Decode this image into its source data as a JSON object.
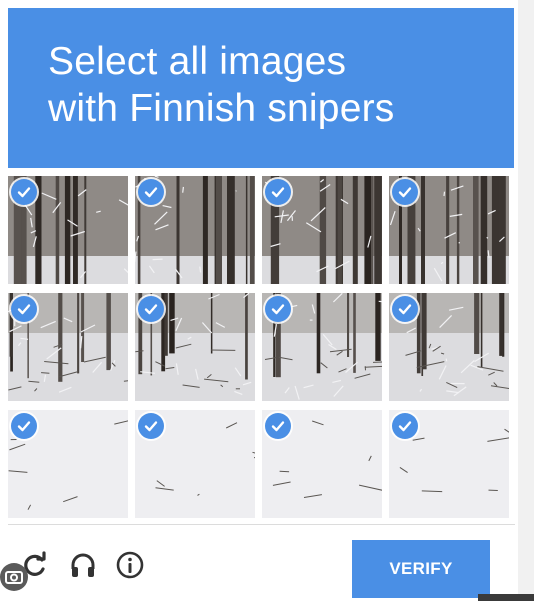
{
  "header": {
    "line1": "Select all images",
    "line2": "with Finnish snipers"
  },
  "grid": {
    "rows": 3,
    "cols": 4,
    "tiles": [
      {
        "scene": "dense-snowy-forest-trunks",
        "selected": true
      },
      {
        "scene": "bright-snowy-birch-forest",
        "selected": true
      },
      {
        "scene": "tall-dark-trunks-snow",
        "selected": true
      },
      {
        "scene": "dark-spruce-forest",
        "selected": true
      },
      {
        "scene": "snowy-forest-floor-branches",
        "selected": true
      },
      {
        "scene": "snowy-path-between-trees",
        "selected": true
      },
      {
        "scene": "fallen-branches-in-snow",
        "selected": true
      },
      {
        "scene": "forest-edge-snowdrift",
        "selected": true
      },
      {
        "scene": "snowfield-with-tracks",
        "selected": true
      },
      {
        "scene": "open-snow-clearing",
        "selected": true
      },
      {
        "scene": "snow-covered-brush",
        "selected": true
      },
      {
        "scene": "snow-laden-fallen-log",
        "selected": true
      }
    ],
    "check_icon": "check-icon",
    "accent_color": "#4a8fe5"
  },
  "footer": {
    "icons": [
      "reload-icon",
      "headphones-icon",
      "info-icon"
    ],
    "verify_label": "VERIFY"
  },
  "overlay": {
    "icon": "lens-icon"
  }
}
